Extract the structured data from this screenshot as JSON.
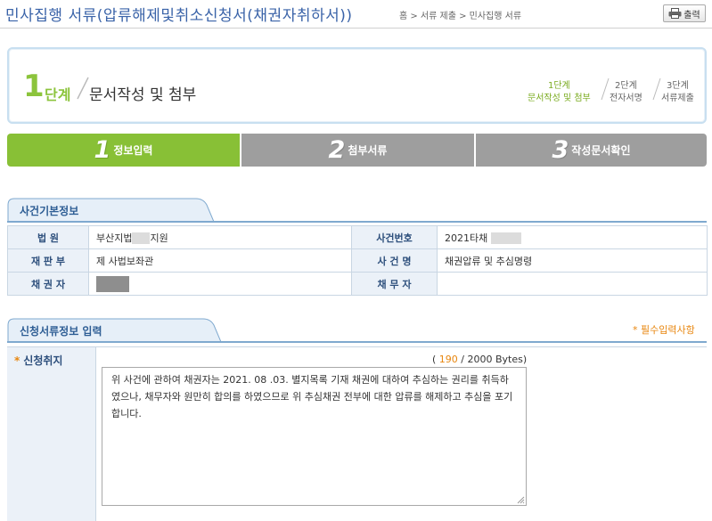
{
  "header": {
    "title": "민사집행 서류(압류해제및취소신청서(채권자취하서))",
    "breadcrumb": "홈 > 서류 제출 > 민사집행 서류",
    "print_label": "출력"
  },
  "step_box": {
    "num": "1",
    "word": "단계",
    "name": "문서작성 및 첨부",
    "mini": [
      {
        "line1": "1단계",
        "line2": "문서작성 및 첨부"
      },
      {
        "line1": "2단계",
        "line2": "전자서명"
      },
      {
        "line1": "3단계",
        "line2": "서류제출"
      }
    ]
  },
  "tabs": [
    {
      "num": "1",
      "label": "정보입력",
      "active": true
    },
    {
      "num": "2",
      "label": "첨부서류",
      "active": false
    },
    {
      "num": "3",
      "label": "작성문서확인",
      "active": false
    }
  ],
  "case_section": {
    "title": "사건기본정보",
    "court_label": "법 원",
    "court_value_prefix": "부산지법",
    "court_value_suffix": "지원",
    "case_no_label": "사건번호",
    "case_no_value": "2021타채",
    "division_label": "재 판 부",
    "division_value": "제 사법보좌관",
    "case_name_label": "사 건 명",
    "case_name_value": "채권압류 및 추심명령",
    "creditor_label": "채 권 자",
    "debtor_label": "채 무 자",
    "debtor_value": ""
  },
  "form_section": {
    "title": "신청서류정보 입력",
    "required_note": "* 필수입력사항",
    "field_label": "신청취지",
    "bytes_open": "( ",
    "bytes_count": "190",
    "bytes_rest": " / 2000 Bytes)",
    "content": "위 사건에 관하여 채권자는 2021. 08 .03. 별지목록 기재 채권에 대하여 추심하는 권리를 취득하였으나, 채무자와 원만히 합의를 하였으므로 위 추심채권 전부에 대한 압류를 해제하고 추심을 포기합니다."
  },
  "colors": {
    "title_blue": "#3a63a8",
    "active_green": "#88c036",
    "inactive_grey": "#9e9e9e",
    "label_bg": "#ebf1f8",
    "required_orange": "#e8860e"
  }
}
